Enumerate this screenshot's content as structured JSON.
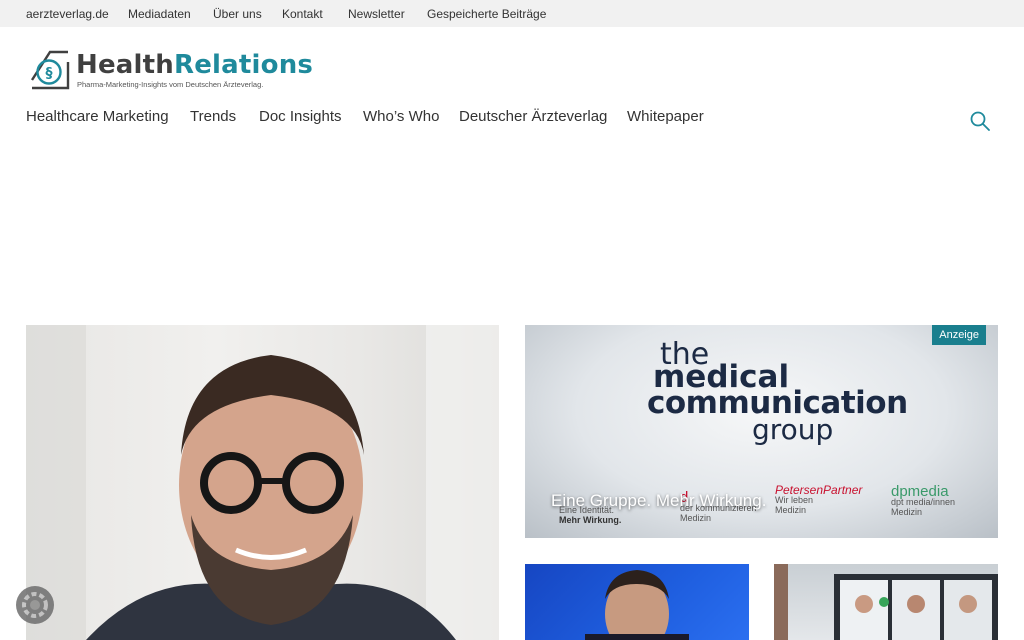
{
  "topbar": {
    "links": [
      "aerzteverlag.de",
      "Mediadaten",
      "Über uns",
      "Kontakt",
      "Newsletter",
      "Gespeicherte Beiträge"
    ]
  },
  "logo": {
    "title_part1": "Health",
    "title_part2": "Relations",
    "tagline": "Pharma-Marketing-Insights vom Deutschen Ärzteverlag.",
    "accent_color": "#1f8a9c"
  },
  "nav": {
    "items": [
      "Healthcare Marketing",
      "Trends",
      "Doc Insights",
      "Who’s Who",
      "Deutscher Ärzteverlag",
      "Whitepaper"
    ],
    "search_icon": "search-icon"
  },
  "ad": {
    "badge": "Anzeige",
    "line_the": "the",
    "line_medical": "medical",
    "line_communication": "communication",
    "line_group": "group",
    "caption": "Eine Gruppe. Mehr Wirkung.",
    "logo1_sub": "Eine Identität.",
    "logo1_main": "Mehr Wirkung.",
    "logo2_name": "d",
    "logo2_sub": "der kommunizieren",
    "logo2_main": "Medizin",
    "logo3_name": "PetersenPartner",
    "logo3_sub": "Wir leben",
    "logo3_main": "Medizin",
    "logo4_name": "dpmedia",
    "logo4_sub": "dpt media/innen",
    "logo4_main": "Medizin",
    "badge_color": "#1a7f8e"
  }
}
